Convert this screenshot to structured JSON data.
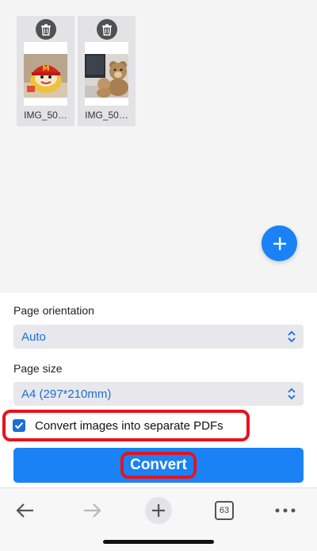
{
  "gallery": {
    "images": [
      {
        "name": "IMG_50…",
        "icon": "trash-icon"
      },
      {
        "name": "IMG_50…",
        "icon": "trash-icon"
      }
    ],
    "add_icon": "plus-icon"
  },
  "settings": {
    "orientation_label": "Page orientation",
    "orientation_value": "Auto",
    "size_label": "Page size",
    "size_value": "A4 (297*210mm)",
    "separate_pdfs_label": "Convert images into separate PDFs",
    "separate_pdfs_checked": true
  },
  "actions": {
    "convert_label": "Convert"
  },
  "toolbar": {
    "tabs_count": "63"
  },
  "colors": {
    "accent": "#1a82f5",
    "highlight": "#e5141f"
  }
}
